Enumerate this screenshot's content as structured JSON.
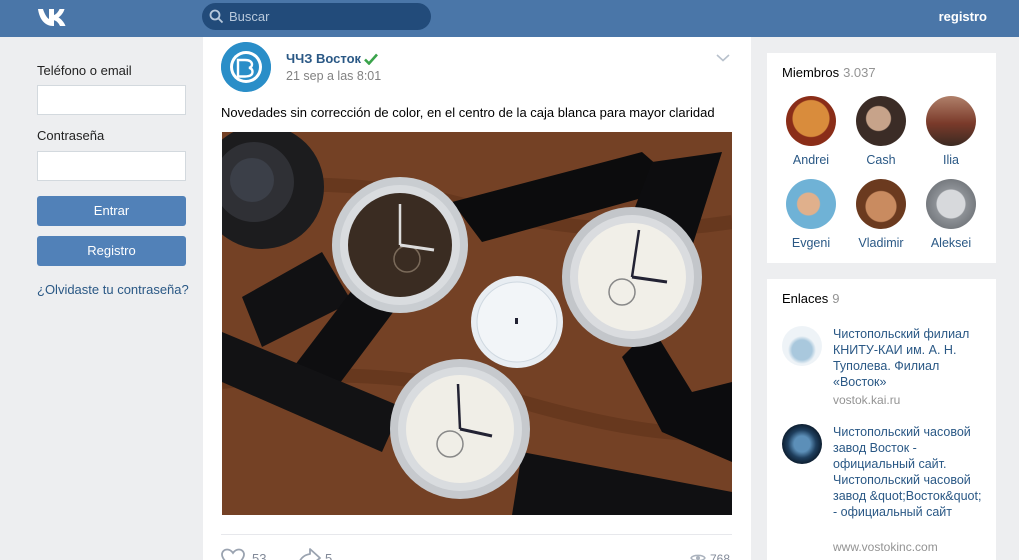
{
  "header": {
    "logo": "VK",
    "search_placeholder": "Buscar",
    "register_link": "registro"
  },
  "login": {
    "phone_label": "Teléfono o email",
    "password_label": "Contraseña",
    "enter_button": "Entrar",
    "register_button": "Registro",
    "forgot_link": "¿Olvidaste tu contraseña?"
  },
  "post": {
    "author": "ЧЧЗ Восток",
    "date": "21 sep a las 8:01",
    "text": "Novedades sin corrección de color, en el centro de la caja blanca para mayor claridad",
    "likes": "53",
    "shares": "5",
    "views": "768"
  },
  "members": {
    "title": "Miembros",
    "count": "3.037",
    "items": [
      {
        "name": "Andrei",
        "color": "#8a5a3a"
      },
      {
        "name": "Cash",
        "color": "#4b3b35"
      },
      {
        "name": "Ilia",
        "color": "#7a3a2a"
      },
      {
        "name": "Evgeni",
        "color": "#5fa4c9"
      },
      {
        "name": "Vladimir",
        "color": "#a86b3e"
      },
      {
        "name": "Aleksei",
        "color": "#8d9196"
      }
    ]
  },
  "links": {
    "title": "Enlaces",
    "count": "9",
    "items": [
      {
        "title": "Чистопольский филиал КНИТУ-КАИ им. А. Н. Туполева. Филиал «Восток»",
        "url": "vostok.kai.ru"
      },
      {
        "title": "Чистопольский часовой завод Восток - официальный сайт. Чистопольский часовой завод &quot;Восток&quot; - официальный сайт",
        "url": "www.vostokinc.com"
      }
    ]
  },
  "colors": {
    "header": "#4a76a8",
    "button": "#5181b8",
    "link": "#2a5885",
    "background": "#edeef0"
  }
}
